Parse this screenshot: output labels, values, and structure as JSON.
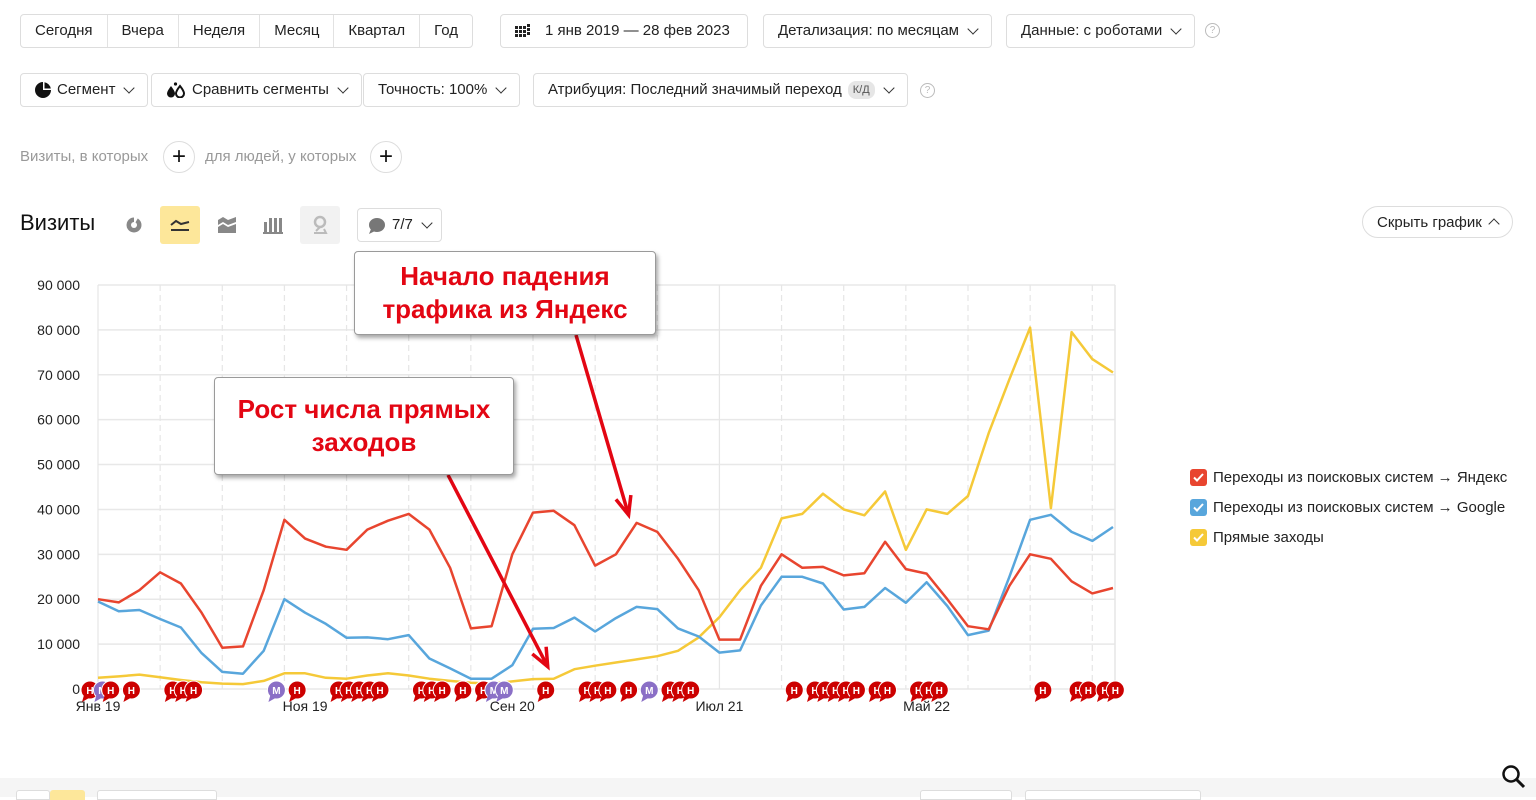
{
  "period_buttons": [
    "Сегодня",
    "Вчера",
    "Неделя",
    "Месяц",
    "Квартал",
    "Год"
  ],
  "date_range": {
    "icon": "calendar-grid-icon",
    "label": "1 янв 2019 — 28 фев 2023"
  },
  "detail_dropdown": "Детализация: по месяцам",
  "data_dropdown": "Данные: с роботами",
  "segment_button": "Сегмент",
  "compare_button": "Сравнить сегменты",
  "accuracy_dropdown": "Точность: 100%",
  "attribution_dropdown": "Атрибуция: Последний значимый переход",
  "attribution_badge": "К/Д",
  "help_glyph": "?",
  "filter": {
    "visits_label": "Визиты, в которых",
    "people_label": "для людей, у которых",
    "add_glyph": "+"
  },
  "report": {
    "title": "Визиты",
    "chart_types": [
      "pie-chart-icon",
      "line-chart-icon",
      "area-chart-icon",
      "bar-chart-icon",
      "map-pin-icon"
    ],
    "notes_counter": "7/7",
    "hide_chart": "Скрыть график"
  },
  "callouts": [
    {
      "text": "Начало падения трафика из Яндекс"
    },
    {
      "text": "Рост числа прямых заходов"
    }
  ],
  "annotation_markers": {
    "note": "Н",
    "metrika": "М"
  },
  "chart_data": {
    "type": "line",
    "title": "Визиты",
    "xlabel": "",
    "ylabel": "",
    "ylim": [
      0,
      90000
    ],
    "yticks": [
      0,
      10000,
      20000,
      30000,
      40000,
      50000,
      60000,
      70000,
      80000,
      90000
    ],
    "ytick_labels": [
      "0",
      "10 000",
      "20 000",
      "30 000",
      "40 000",
      "50 000",
      "60 000",
      "70 000",
      "80 000",
      "90 000"
    ],
    "xtick_labels": [
      {
        "index": 0,
        "label": "Янв 19"
      },
      {
        "index": 10,
        "label": "Ноя 19"
      },
      {
        "index": 20,
        "label": "Сен 20"
      },
      {
        "index": 30,
        "label": "Июл 21"
      },
      {
        "index": 40,
        "label": "Май 22"
      }
    ],
    "x_count": 50,
    "grid": true,
    "legend_position": "right",
    "series": [
      {
        "name": "Переходы из поисковых систем → Яндекс",
        "color": "#e8452f",
        "values": [
          20000,
          19300,
          22000,
          26000,
          23500,
          17000,
          9200,
          9500,
          22000,
          37700,
          33500,
          31700,
          31000,
          35500,
          37500,
          39000,
          35500,
          27000,
          13500,
          14000,
          30000,
          39300,
          39700,
          36500,
          27500,
          30000,
          37000,
          35000,
          29000,
          22000,
          11000,
          11000,
          23000,
          30000,
          27000,
          27200,
          25300,
          25800,
          32800,
          26700,
          25700,
          20000,
          14000,
          13300,
          23000,
          30000,
          29000,
          24000,
          21300,
          22500
        ]
      },
      {
        "name": "Переходы из поисковых систем → Google",
        "color": "#58a6dc",
        "values": [
          19500,
          17300,
          17600,
          15600,
          13700,
          8000,
          3800,
          3400,
          8500,
          20000,
          17000,
          14500,
          11400,
          11500,
          11100,
          12000,
          6800,
          4600,
          2300,
          2300,
          5300,
          13400,
          13600,
          15900,
          12800,
          15800,
          18300,
          17800,
          13500,
          11700,
          8100,
          8600,
          18600,
          25000,
          25000,
          23500,
          17700,
          18300,
          22500,
          19200,
          23800,
          18500,
          12000,
          13000,
          25000,
          37700,
          38800,
          35000,
          33000,
          36100
        ]
      },
      {
        "name": "Прямые заходы",
        "color": "#f5c938",
        "values": [
          2500,
          2800,
          3200,
          2600,
          2000,
          1500,
          1200,
          1100,
          1800,
          3500,
          3500,
          2500,
          2300,
          3000,
          3500,
          3000,
          2300,
          1800,
          1400,
          1200,
          1700,
          2200,
          2300,
          4400,
          5200,
          5900,
          6600,
          7300,
          8500,
          11500,
          16000,
          22000,
          27000,
          38000,
          39000,
          43500,
          40000,
          38700,
          44000,
          31000,
          40000,
          39000,
          43000,
          57000,
          69000,
          80500,
          40300,
          79500,
          73500,
          70500
        ]
      }
    ],
    "annotations": [
      {
        "text": "Начало падения трафика из Яндекс",
        "points_to_index": 26,
        "series": "Переходы из поисковых систем → Яндекс"
      },
      {
        "text": "Рост числа прямых заходов",
        "points_to_index": 22,
        "series": "Прямые заходы"
      }
    ]
  }
}
